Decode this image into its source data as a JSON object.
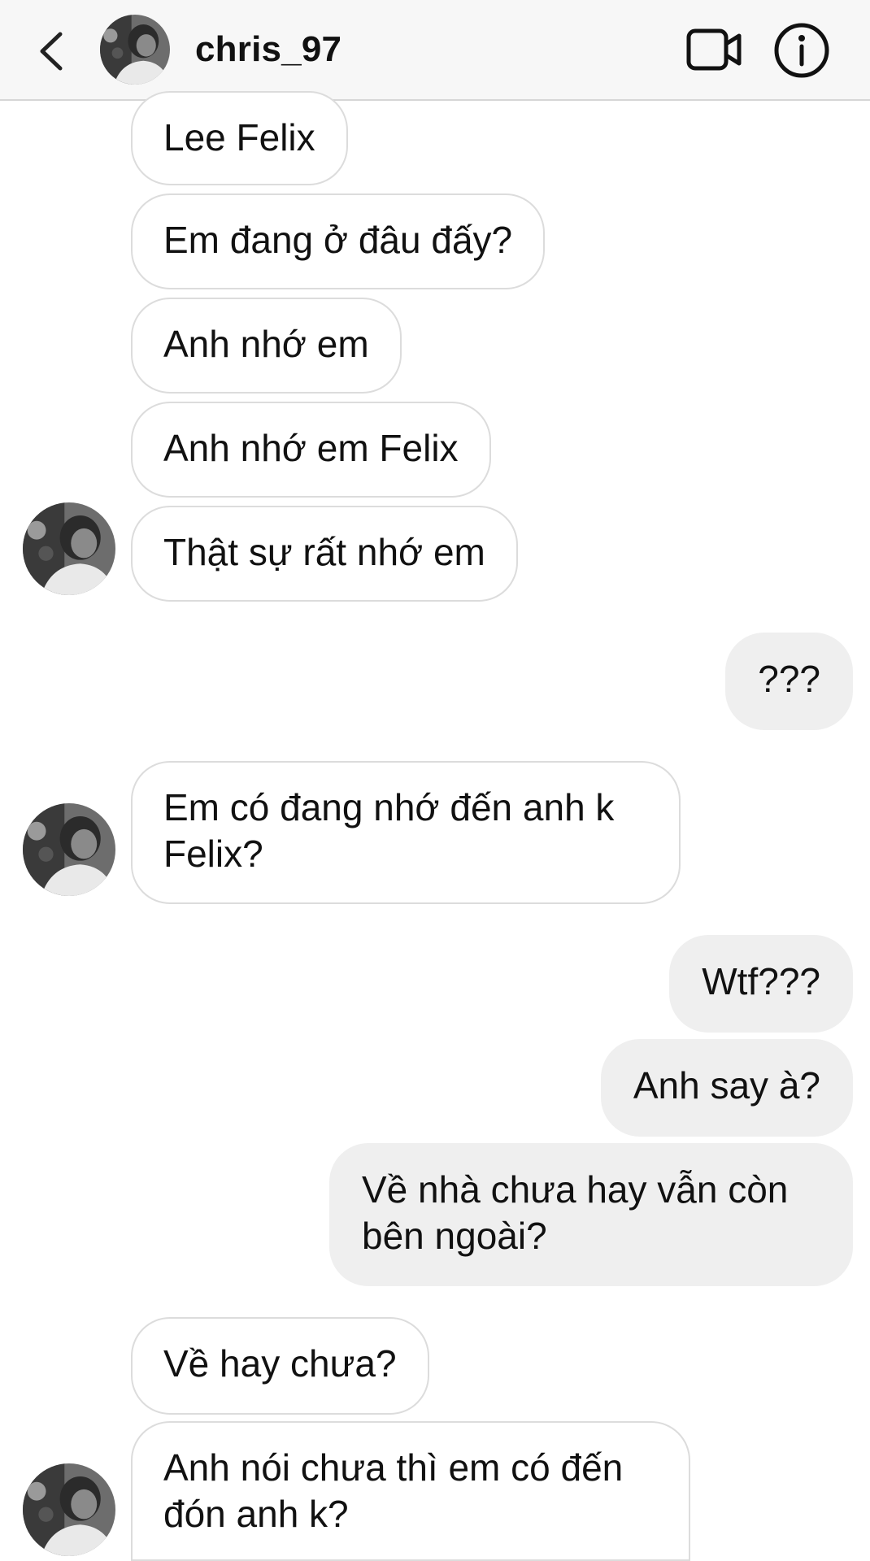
{
  "header": {
    "username": "chris_97",
    "back_icon": "chevron-left-icon",
    "video_icon": "video-camera-icon",
    "info_icon": "info-icon"
  },
  "messages": [
    {
      "from": "them",
      "text": "Lee Felix"
    },
    {
      "from": "them",
      "text": "Em đang ở đâu đấy?"
    },
    {
      "from": "them",
      "text": "Anh nhớ em"
    },
    {
      "from": "them",
      "text": "Anh nhớ em Felix"
    },
    {
      "from": "them",
      "text": "Thật sự rất nhớ em"
    },
    {
      "from": "me",
      "text": "???"
    },
    {
      "from": "them",
      "text": "Em có đang nhớ đến anh k Felix?"
    },
    {
      "from": "me",
      "text": "Wtf???"
    },
    {
      "from": "me",
      "text": "Anh say à?"
    },
    {
      "from": "me",
      "text": "Về nhà chưa hay vẫn còn bên ngoài?"
    },
    {
      "from": "them",
      "text": "Về hay chưa?"
    },
    {
      "from": "them",
      "text": "Anh nói chưa thì em có đến đón anh k?"
    }
  ]
}
